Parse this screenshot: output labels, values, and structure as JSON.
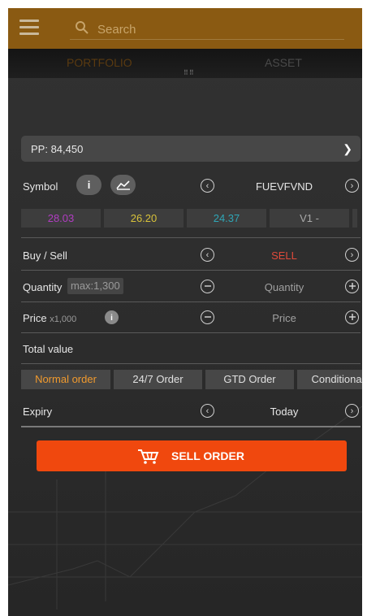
{
  "search": {
    "placeholder": "Search"
  },
  "tabs": [
    "PORTFOLIO",
    "ASSET"
  ],
  "purchasing_power": {
    "label": "PP: 84,450"
  },
  "symbol": {
    "label": "Symbol",
    "info_icon": "info-icon",
    "chart_icon": "chart-icon",
    "value": "FUEVFVND"
  },
  "prices": [
    {
      "value": "28.03",
      "color": "#b13cc2"
    },
    {
      "value": "26.20",
      "color": "#d8c23a"
    },
    {
      "value": "24.37",
      "color": "#2fa6b6"
    },
    {
      "value": "V1 -",
      "color": "#a9a9a9"
    }
  ],
  "buy_sell": {
    "label": "Buy / Sell",
    "value": "SELL",
    "color": "#e04a3a"
  },
  "quantity": {
    "label": "Quantity",
    "max_badge": "max:1,300",
    "placeholder": "Quantity"
  },
  "price": {
    "label": "Price",
    "unit": "x1,000",
    "placeholder": "Price"
  },
  "total_value": {
    "label": "Total value"
  },
  "order_types": [
    {
      "label": "Normal order",
      "active": true
    },
    {
      "label": "24/7 Order",
      "active": false
    },
    {
      "label": "GTD Order",
      "active": false
    },
    {
      "label": "Conditional",
      "active": false
    }
  ],
  "expiry": {
    "label": "Expiry",
    "value": "Today"
  },
  "sell_button": {
    "label": "SELL ORDER",
    "color": "#f0480e"
  },
  "colors": {
    "header": "#8a5a12",
    "accent": "#f09a2e"
  }
}
